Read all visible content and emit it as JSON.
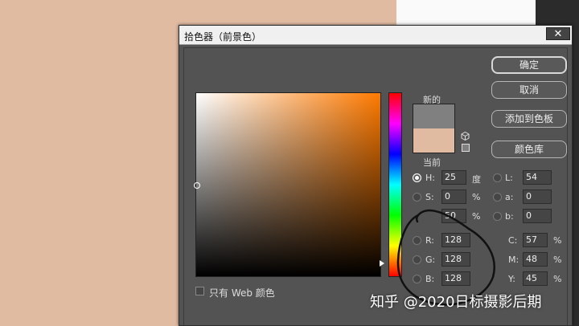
{
  "dialog": {
    "title": "拾色器（前景色）",
    "close_glyph": "✕"
  },
  "swatch": {
    "new_label": "新的",
    "current_label": "当前",
    "new_color": "#808080",
    "current_color": "#e0bba1"
  },
  "buttons": {
    "ok": "确定",
    "cancel": "取消",
    "add_to_swatches": "添加到色板",
    "color_libraries": "颜色库"
  },
  "hsb": {
    "h_label": "H:",
    "h_value": "25",
    "h_unit": "度",
    "s_label": "S:",
    "s_value": "0",
    "s_unit": "%",
    "b_value": "50",
    "b_unit": "%"
  },
  "rgb": {
    "r_label": "R:",
    "r_value": "128",
    "g_label": "G:",
    "g_value": "128",
    "b_label": "B:",
    "b_value": "128"
  },
  "lab": {
    "l_label": "L:",
    "l_value": "54",
    "a_label": "a:",
    "a_value": "0",
    "b_label": "b:",
    "b_value": "0"
  },
  "cmyk": {
    "c_label": "C:",
    "c_value": "57",
    "c_unit": "%",
    "m_label": "M:",
    "m_value": "48",
    "m_unit": "%",
    "y_label": "Y:",
    "y_value": "45",
    "y_unit": "%"
  },
  "web_only_label": "只有 Web 颜色",
  "watermark": "知乎 @2020日标摄影后期",
  "colors": {
    "background_skin": "#e0bba1",
    "hue_top": "#ff7a00",
    "dialog_bg": "#535353"
  }
}
